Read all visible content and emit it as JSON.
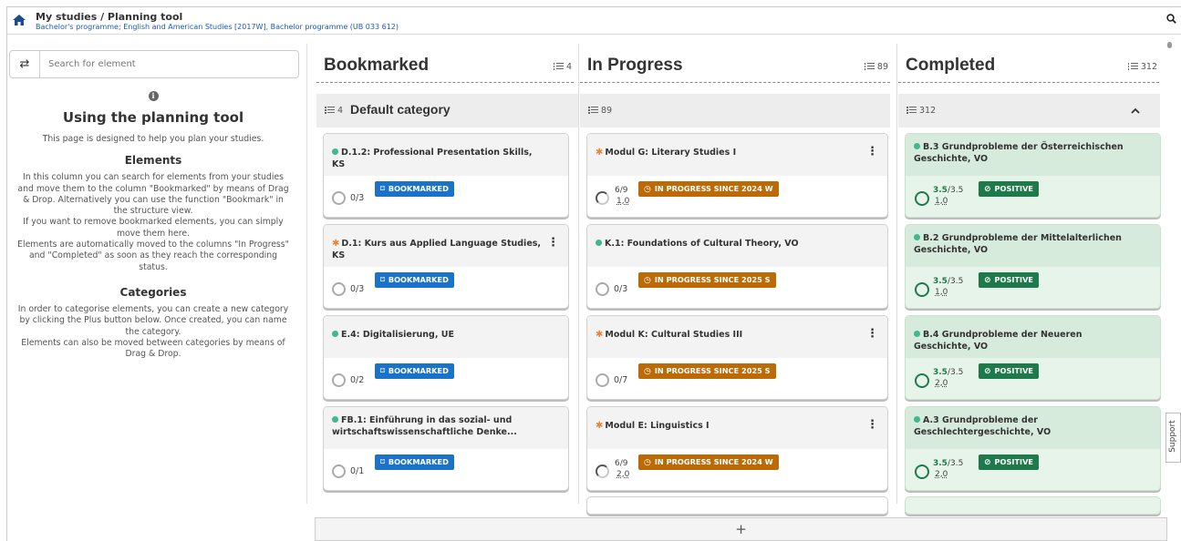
{
  "header": {
    "title": "My studies / Planning tool",
    "subtitle": "Bachelor's programme; English and American Studies [2017W], Bachelor programme (UB 033 612)"
  },
  "search": {
    "placeholder": "Search for element"
  },
  "help": {
    "title": "Using the planning tool",
    "intro": "This page is designed to help you plan your studies.",
    "elements_heading": "Elements",
    "elements_text": "In this column you can search for elements from your studies and move them to the column \"Bookmarked\" by means of Drag & Drop. Alternatively you can use the function \"Bookmark\" in the structure view.",
    "elements_text2": "If you want to remove bookmarked elements, you can simply move them here.",
    "elements_text3": "Elements are automatically moved to the columns \"In Progress\" and \"Completed\" as soon as they reach the corresponding status.",
    "categories_heading": "Categories",
    "categories_text": "In order to categorise elements, you can create a new category by clicking the Plus button below. Once created, you can name the category.",
    "categories_text2": "Elements can also be moved between categories by means of Drag & Drop."
  },
  "columns": {
    "bookmarked": {
      "title": "Bookmarked",
      "count": "4",
      "category": {
        "count": "4",
        "name": "Default category"
      },
      "cards": [
        {
          "title": "D.1.2: Professional Presentation Skills, KS",
          "marker": "dot",
          "progress": "0/3",
          "badge": "BOOKMARKED"
        },
        {
          "title": "D.1: Kurs aus Applied Language Studies, KS",
          "marker": "star",
          "progress": "0/3",
          "badge": "BOOKMARKED"
        },
        {
          "title": "E.4: Digitalisierung, UE",
          "marker": "dot",
          "progress": "0/2",
          "badge": "BOOKMARKED"
        },
        {
          "title": "FB.1: Einführung in das sozial- und wirtschaftswissenschaftliche Denke...",
          "marker": "dot",
          "progress": "0/1",
          "badge": "BOOKMARKED"
        }
      ]
    },
    "in_progress": {
      "title": "In Progress",
      "count": "89",
      "category": {
        "count": "89"
      },
      "cards": [
        {
          "title": "Modul G: Literary Studies I",
          "marker": "star",
          "progress": "6/9",
          "ects": "1,0",
          "badge": "IN PROGRESS SINCE 2024 W"
        },
        {
          "title": "K.1: Foundations of Cultural Theory, VO",
          "marker": "dot",
          "progress": "0/3",
          "badge": "IN PROGRESS SINCE 2025 S"
        },
        {
          "title": "Modul K: Cultural Studies III",
          "marker": "star",
          "progress": "0/7",
          "badge": "IN PROGRESS SINCE 2025 S"
        },
        {
          "title": "Modul E: Linguistics I",
          "marker": "star",
          "progress": "6/9",
          "ects": "2,0",
          "badge": "IN PROGRESS SINCE 2024 W"
        }
      ]
    },
    "completed": {
      "title": "Completed",
      "count": "312",
      "category": {
        "count": "312"
      },
      "cards": [
        {
          "title": "B.3 Grundprobleme der Österreichischen Geschichte, VO",
          "progress_num": "3.5",
          "progress_den": "/3.5",
          "ects": "1,0",
          "badge": "POSITIVE"
        },
        {
          "title": "B.2 Grundprobleme der Mittelalterlichen Geschichte, VO",
          "progress_num": "3.5",
          "progress_den": "/3.5",
          "ects": "1,0",
          "badge": "POSITIVE"
        },
        {
          "title": "B.4 Grundprobleme der Neueren Geschichte, VO",
          "progress_num": "3.5",
          "progress_den": "/3.5",
          "ects": "2,0",
          "badge": "POSITIVE"
        },
        {
          "title": "A.3 Grundprobleme der Geschlechtergeschichte, VO",
          "progress_num": "3.5",
          "progress_den": "/3.5",
          "ects": "2,0",
          "badge": "POSITIVE"
        }
      ]
    }
  },
  "add_button": "+",
  "support": "Support"
}
